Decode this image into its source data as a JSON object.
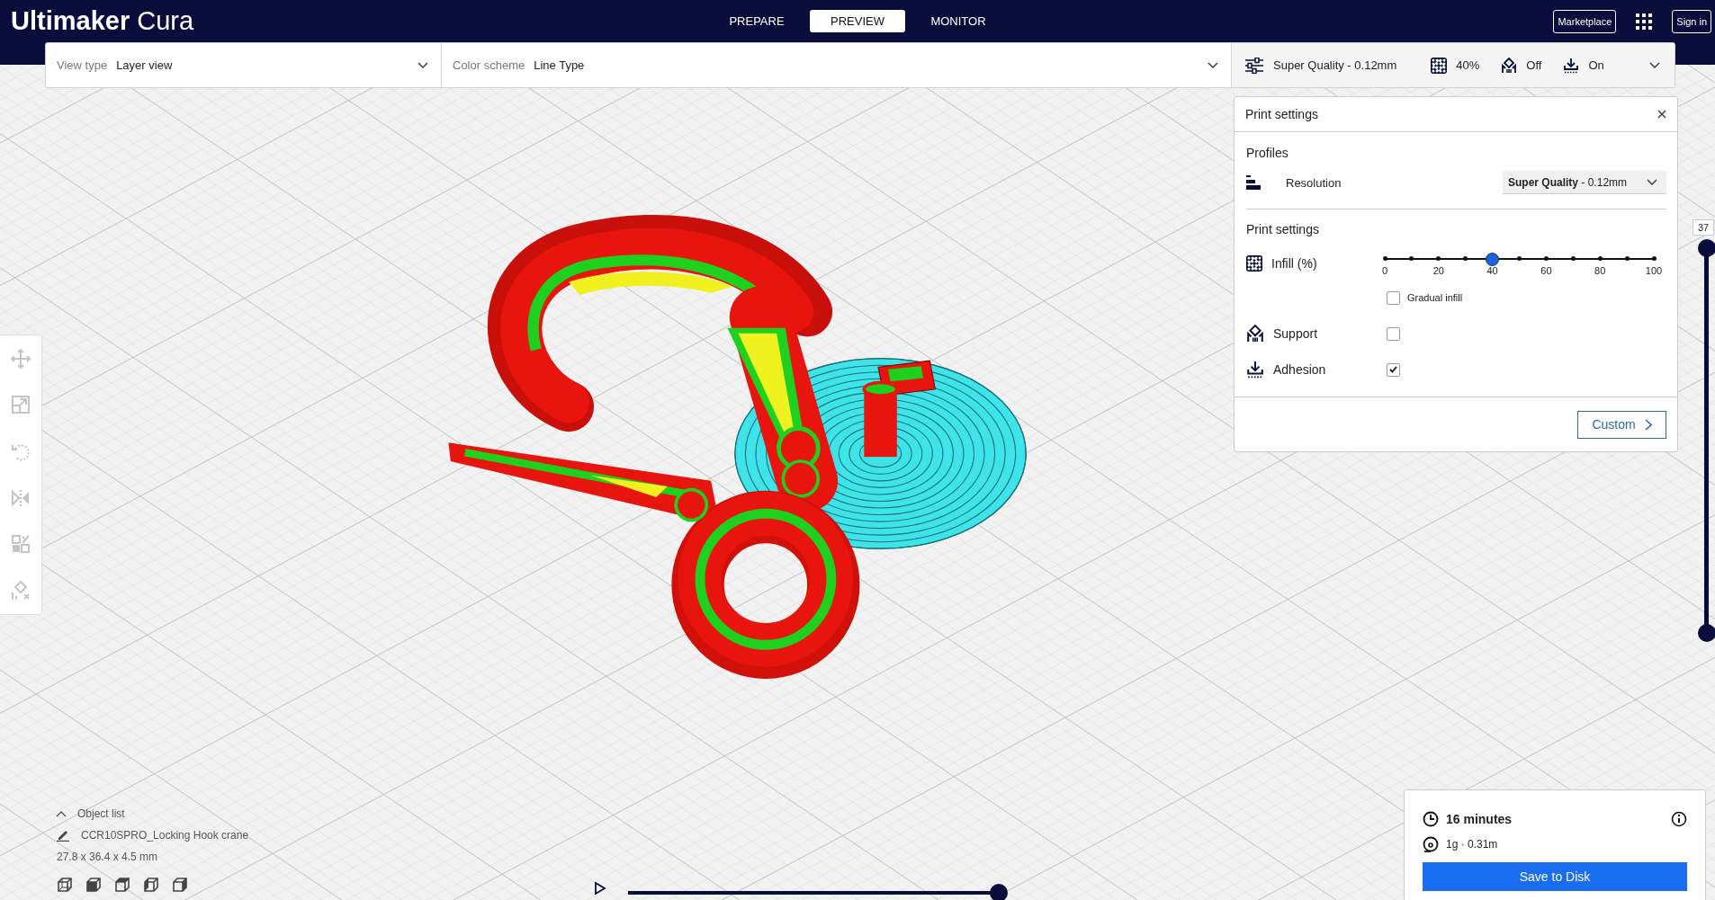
{
  "app": {
    "logo_bold": "Ultimaker",
    "logo_light": "Cura"
  },
  "stages": [
    {
      "label": "PREPARE",
      "selected": false
    },
    {
      "label": "PREVIEW",
      "selected": true
    },
    {
      "label": "MONITOR",
      "selected": false
    }
  ],
  "header_buttons": [
    "Marketplace",
    "Sign in"
  ],
  "toolbar": {
    "view_type": {
      "label": "View type",
      "value": "Layer view"
    },
    "color_scheme": {
      "label": "Color scheme",
      "value": "Line Type"
    },
    "summary": {
      "profile": "Super Quality - 0.12mm",
      "infill": "40%",
      "support": "Off",
      "adhesion": "On"
    }
  },
  "tools": [
    {
      "kind": "move",
      "disabled": true
    },
    {
      "kind": "scale",
      "disabled": true
    },
    {
      "kind": "rotate",
      "disabled": true
    },
    {
      "kind": "mirror",
      "disabled": true
    },
    {
      "kind": "per_model",
      "disabled": true
    },
    {
      "kind": "support_blocker",
      "disabled": true
    }
  ],
  "print_settings": {
    "title": "Print settings",
    "profiles_heading": "Profiles",
    "resolution_label": "Resolution",
    "profile_name": "**Super Quality** - 0.12mm",
    "settings_heading": "Print settings",
    "infill": {
      "label": "Infill (%)",
      "level": 0.4,
      "ticks": [
        "0",
        "20",
        "40",
        "60",
        "80",
        "100"
      ]
    },
    "gradual_infill": {
      "label": "Gradual infill",
      "checked": false
    },
    "support": {
      "label": "Support",
      "checked": false
    },
    "adhesion": {
      "label": "Adhesion",
      "checked": true
    },
    "custom_button": "Custom"
  },
  "layer_slider": {
    "label": "37",
    "level": 1
  },
  "path_slider": {
    "level": 1
  },
  "object_list": {
    "title": "Object list",
    "expanded": true,
    "object_name": "CCR10SPRO_Locking Hook crane",
    "dimensions": "27.8 x 36.4 x 4.5 mm"
  },
  "view_buttons": [
    {
      "kind": "iso"
    },
    {
      "kind": "front"
    },
    {
      "kind": "top"
    },
    {
      "kind": "left"
    },
    {
      "kind": "right"
    }
  ],
  "print_info": {
    "time": "16 minutes",
    "material": "1g · 0.31m",
    "save_button": "Save to Disk"
  }
}
